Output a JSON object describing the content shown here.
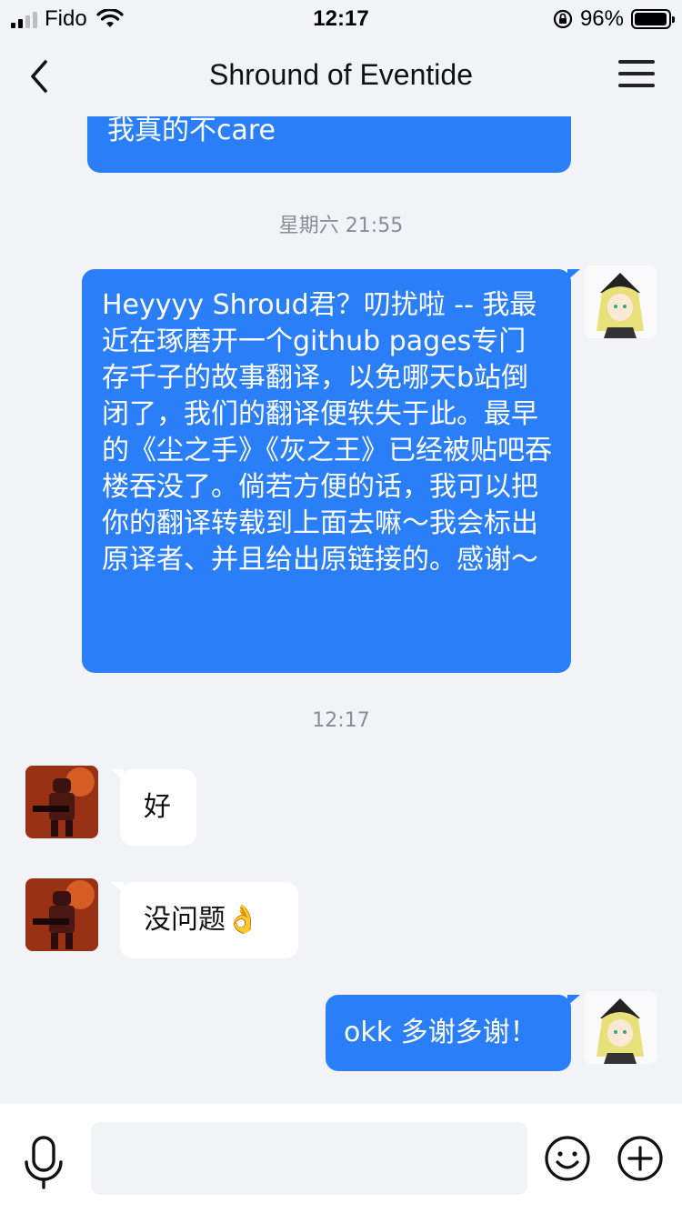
{
  "status": {
    "carrier": "Fido",
    "time": "12:17",
    "battery": "96%",
    "battery_level": 0.96
  },
  "nav": {
    "title": "Shround of Eventide"
  },
  "messages": {
    "m0": "我真的不care",
    "ts1": "星期六 21:55",
    "m1": "Heyyyy Shroud君？叨扰啦 -- 我最近在琢磨开一个github pages专门存千子的故事翻译，以免哪天b站倒闭了，我们的翻译便轶失于此。最早的《尘之手》《灰之王》已经被贴吧吞楼吞没了。倘若方便的话，我可以把你的翻译转载到上面去嘛～我会标出原译者、并且给出原链接的。感谢～",
    "ts2": "12:17",
    "m2": "好",
    "m3": "没问题👌",
    "m4": "okk 多谢多谢！"
  },
  "input": {
    "placeholder": ""
  },
  "colors": {
    "my_bubble": "#2a7ef8",
    "their_bubble": "#ffffff",
    "background": "#f2f3f7"
  }
}
